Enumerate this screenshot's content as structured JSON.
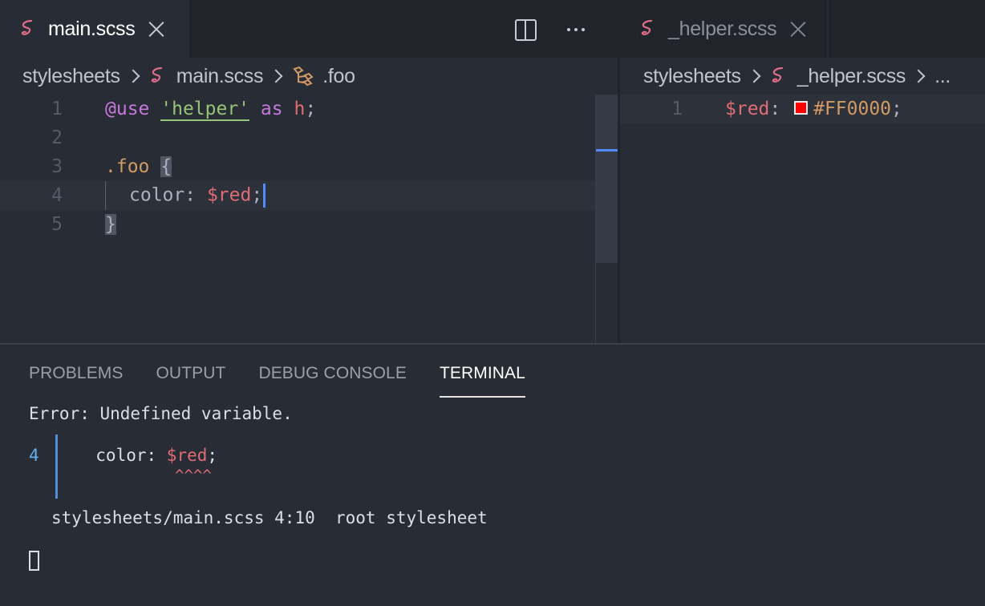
{
  "colors": {
    "editor_bg": "#282c34",
    "tabbar_bg": "#21252b",
    "sass_pink": "#e06c8c",
    "keyword": "#c678dd",
    "string": "#98c379",
    "variable": "#e06c75",
    "selector": "#d19a66",
    "swatch": "#ff0000",
    "terminal_gutter": "#4f8fd8"
  },
  "left_group": {
    "tab": {
      "label": "main.scss",
      "icon": "sass-icon"
    },
    "actions": {
      "split": "split-editor-icon",
      "more": "more-actions-icon"
    },
    "breadcrumb": {
      "folder": "stylesheets",
      "file": "main.scss",
      "symbol": ".foo"
    },
    "lines": [
      {
        "no": "1",
        "tokens": {
          "at": "@use",
          "str": "'helper'",
          "kw": "as",
          "ns": "h",
          "semi": ";"
        }
      },
      {
        "no": "2"
      },
      {
        "no": "3",
        "tokens": {
          "sel": ".foo",
          "brace": "{"
        }
      },
      {
        "no": "4",
        "tokens": {
          "prop": "color: ",
          "var": "$red",
          "semi": ";"
        }
      },
      {
        "no": "5",
        "tokens": {
          "brace": "}"
        }
      }
    ]
  },
  "right_group": {
    "tab": {
      "label": "_helper.scss",
      "icon": "sass-icon"
    },
    "breadcrumb": {
      "folder": "stylesheets",
      "file": "_helper.scss",
      "more": "..."
    },
    "lines": [
      {
        "no": "1",
        "tokens": {
          "var": "$red",
          "colon": ": ",
          "value": "#FF0000",
          "semi": ";"
        }
      }
    ]
  },
  "panel": {
    "tabs": [
      "PROBLEMS",
      "OUTPUT",
      "DEBUG CONSOLE",
      "TERMINAL"
    ],
    "active_tab": "TERMINAL",
    "terminal": {
      "error": "Error: Undefined variable.",
      "line_no": "4",
      "code_prefix": "  color: ",
      "code_var": "$red",
      "code_suffix": ";",
      "carets": "^^^^",
      "location": "stylesheets/main.scss 4:10  root stylesheet"
    }
  }
}
